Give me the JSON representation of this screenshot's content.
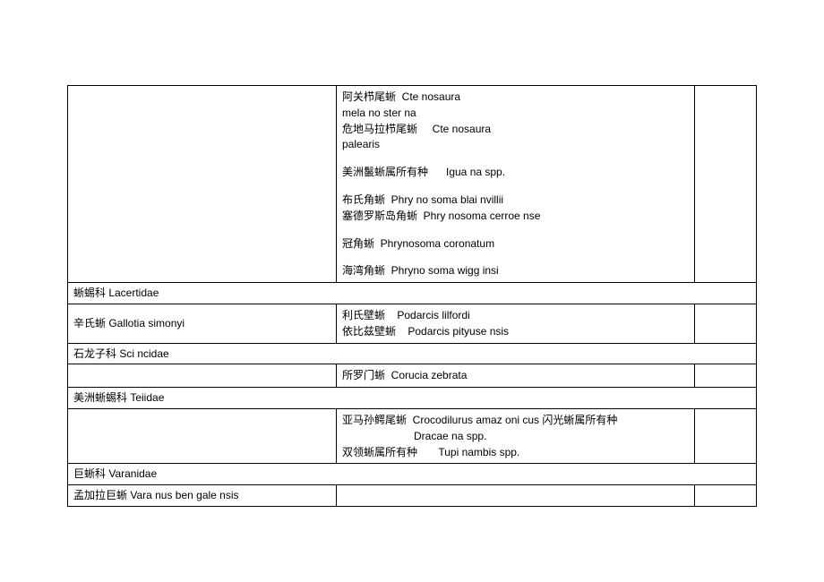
{
  "rows": [
    {
      "type": "data",
      "col1": "",
      "col2_lines": [
        "阿关栉尾蜥  Cte nosaura",
        "mela no ster na",
        "危地马拉栉尾蜥     Cte nosaura",
        "palearis",
        "",
        "美洲鬣蜥属所有种      Igua na spp.",
        "",
        "布氏角蜥  Phry no soma blai nvillii",
        "塞德罗斯岛角蜥  Phry nosoma cerroe nse",
        "",
        "冠角蜥  Phrynosoma coronatum",
        "",
        "海湾角蜥  Phryno soma wigg insi"
      ],
      "col3": ""
    },
    {
      "type": "header",
      "text": "蜥蜴科  Lacertidae"
    },
    {
      "type": "data",
      "col1": "辛氏蜥  Gallotia simonyi",
      "col2_lines": [
        "利氏壁蜥    Podarcis lilfordi",
        "依比兹壁蜥    Podarcis pityuse nsis"
      ],
      "col3": ""
    },
    {
      "type": "header",
      "text": "石龙子科  Sci ncidae"
    },
    {
      "type": "data",
      "col1": "",
      "col2_lines": [
        "所罗门蜥  Corucia zebrata"
      ],
      "col3": ""
    },
    {
      "type": "header",
      "text": "美洲蜥蜴科  Teiidae"
    },
    {
      "type": "data",
      "col1": "",
      "col2_lines": [
        "亚马孙鳄尾蜥  Crocodilurus amaz oni cus 闪光蜥属所有种",
        "                        Dracae na spp.",
        "双领蜥属所有种       Tupi nambis spp."
      ],
      "col3": ""
    },
    {
      "type": "header",
      "text": "巨蜥科  Varanidae"
    },
    {
      "type": "data3",
      "col1": "孟加拉巨蜥    Vara nus ben gale nsis",
      "col2": "",
      "col3": ""
    }
  ]
}
